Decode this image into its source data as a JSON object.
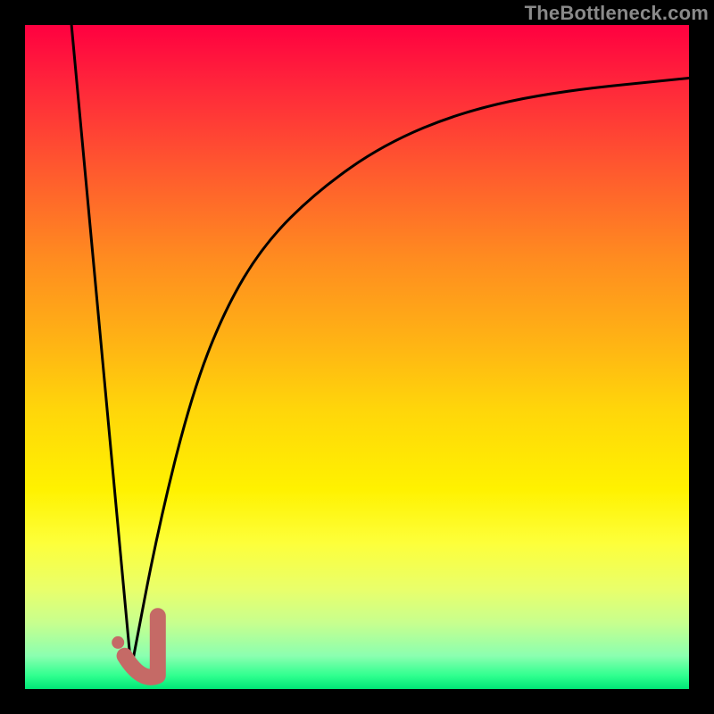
{
  "watermark": "TheBottleneck.com",
  "colors": {
    "curve": "#000000",
    "marker": "#c56a66",
    "gradient_top": "#ff0040",
    "gradient_bottom": "#00e676"
  },
  "chart_data": {
    "type": "line",
    "title": "",
    "xlabel": "",
    "ylabel": "",
    "xlim": [
      0,
      100
    ],
    "ylim": [
      0,
      100
    ],
    "grid": false,
    "legend": null,
    "annotations": [
      {
        "text": "TheBottleneck.com",
        "position": "top-right"
      }
    ],
    "series": [
      {
        "name": "descending-line",
        "description": "Steep near-linear drop from top-left to valley floor",
        "x": [
          7,
          16
        ],
        "y": [
          100,
          3
        ]
      },
      {
        "name": "ascending-curve",
        "description": "Concave rising curve from valley toward upper-right",
        "x": [
          16,
          20,
          25,
          30,
          36,
          44,
          54,
          66,
          80,
          100
        ],
        "y": [
          3,
          24,
          44,
          57,
          67,
          75,
          82,
          87,
          90,
          92
        ]
      }
    ],
    "markers": [
      {
        "name": "j-hook",
        "shape": "J",
        "color": "#c56a66",
        "x_range": [
          15,
          20
        ],
        "y_range": [
          2,
          11
        ]
      },
      {
        "name": "dot",
        "shape": "circle",
        "color": "#c56a66",
        "x": 14,
        "y": 7
      }
    ],
    "valley_x": 16,
    "valley_y": 3
  }
}
